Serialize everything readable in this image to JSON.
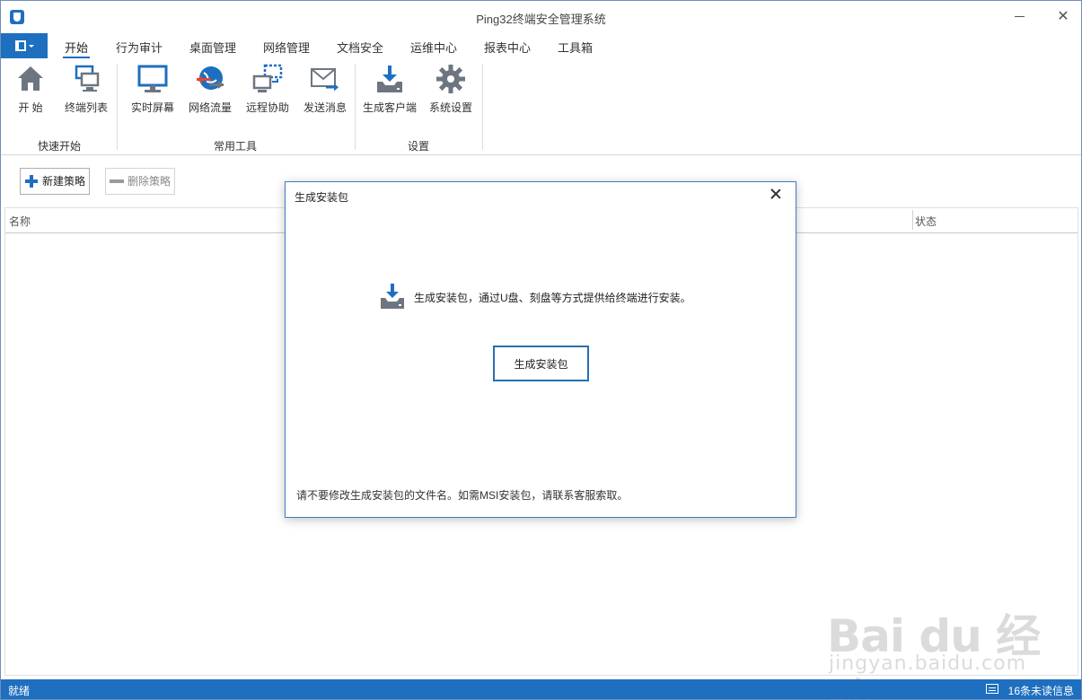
{
  "window": {
    "title": "Ping32终端安全管理系统"
  },
  "ribbon": {
    "tabs": [
      {
        "label": "开始",
        "active": true
      },
      {
        "label": "行为审计"
      },
      {
        "label": "桌面管理"
      },
      {
        "label": "网络管理"
      },
      {
        "label": "文档安全"
      },
      {
        "label": "运维中心"
      },
      {
        "label": "报表中心"
      },
      {
        "label": "工具箱"
      }
    ],
    "groups": [
      {
        "label": "快速开始",
        "buttons": [
          {
            "label": "开  始",
            "icon": "home-icon"
          },
          {
            "label": "终端列表",
            "icon": "terminals-icon"
          }
        ]
      },
      {
        "label": "常用工具",
        "buttons": [
          {
            "label": "实时屏幕",
            "icon": "monitor-icon"
          },
          {
            "label": "网络流量",
            "icon": "network-traffic-icon"
          },
          {
            "label": "远程协助",
            "icon": "remote-assist-icon"
          },
          {
            "label": "发送消息",
            "icon": "send-message-icon"
          }
        ]
      },
      {
        "label": "设置",
        "buttons": [
          {
            "label": "生成客户端",
            "icon": "download-icon"
          },
          {
            "label": "系统设置",
            "icon": "gear-icon"
          }
        ]
      }
    ]
  },
  "toolbar": {
    "new_label": "新建策略",
    "delete_label": "删除策略"
  },
  "table": {
    "columns": [
      "名称",
      "状态"
    ]
  },
  "dialog": {
    "title": "生成安装包",
    "message": "生成安装包，通过U盘、刻盘等方式提供给终端进行安装。",
    "button_label": "生成安装包",
    "note": "请不要修改生成安装包的文件名。如需MSI安装包，请联系客服索取。"
  },
  "status": {
    "left": "就绪",
    "right": "16条未读信息"
  },
  "watermark": {
    "text": "Bai du 经验",
    "sub": "jingyan.baidu.com"
  },
  "colors": {
    "accent": "#1e6fbf",
    "dialog_border": "#3f7bbf"
  }
}
